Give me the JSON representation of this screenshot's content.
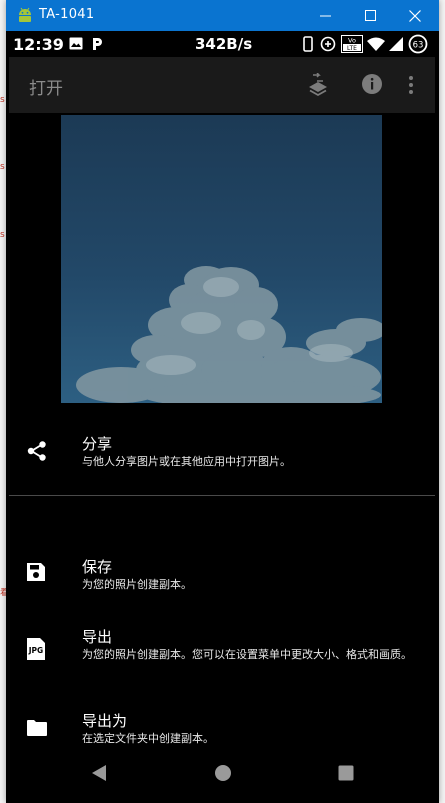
{
  "window": {
    "title": "TA-1041"
  },
  "status_bar": {
    "time": "12:39",
    "speed": "342B/s",
    "battery": "63"
  },
  "app_bar": {
    "title": "打开"
  },
  "share_sheet": {
    "items": [
      {
        "label": "分享",
        "description": "与他人分享图片或在其他应用中打开图片。"
      },
      {
        "label": "保存",
        "description": "为您的照片创建副本。"
      },
      {
        "label": "导出",
        "description": "为您的照片创建副本。您可以在设置菜单中更改大小、格式和画质。"
      },
      {
        "label": "导出为",
        "description": "在选定文件夹中创建副本。"
      }
    ]
  },
  "icons": {
    "android": "android-icon",
    "share": "share-icon",
    "save": "save-icon",
    "jpg": "jpg-file-icon",
    "folder": "folder-icon",
    "jpg_text": "JPG"
  },
  "colors": {
    "titlebar": "#0a74d0",
    "sheet": "#000000",
    "text": "#ffffff"
  }
}
